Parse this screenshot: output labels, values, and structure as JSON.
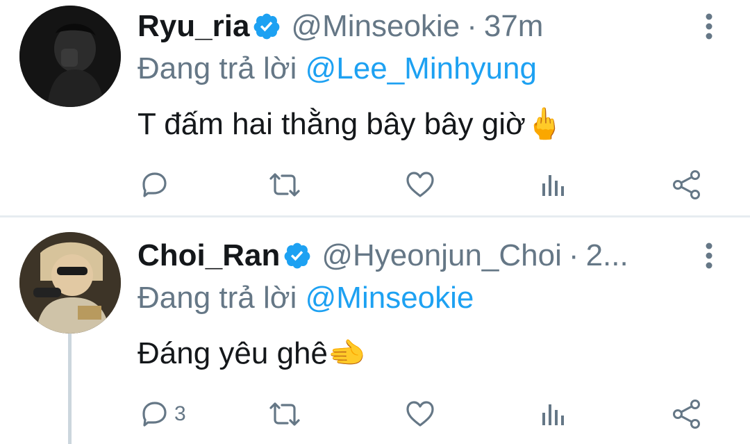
{
  "tweets": [
    {
      "display_name": "Ryu_ria",
      "handle": "@Minseokie",
      "separator": "·",
      "time": "37m",
      "replying_label": "Đang trả lời",
      "replying_to": "@Lee_Minhyung",
      "text": "T đấm hai thằng bây bây giờ",
      "emoji": "🖕",
      "reply_count": "",
      "verified": true
    },
    {
      "display_name": "Choi_Ran",
      "handle": "@Hyeonjun_Choi",
      "separator": "·",
      "time": "2...",
      "replying_label": "Đang trả lời",
      "replying_to": "@Minseokie",
      "text": "Đáng yêu ghê",
      "emoji": "🫲",
      "reply_count": "3",
      "verified": true
    }
  ],
  "colors": {
    "verified_badge": "#1da1f2",
    "mention": "#1da1f2",
    "secondary_text": "#657786",
    "separator": "#e6ecf0",
    "thread_line": "#ccd6dd"
  },
  "icons": [
    "verified-badge-icon",
    "more-vertical-icon",
    "reply-icon",
    "retweet-icon",
    "like-icon",
    "analytics-icon",
    "share-icon"
  ]
}
